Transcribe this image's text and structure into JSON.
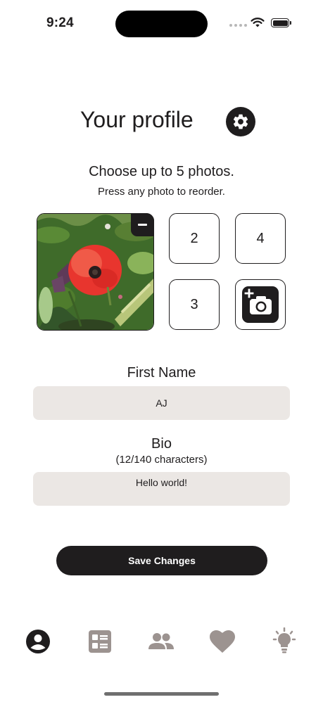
{
  "status_bar": {
    "time": "9:24"
  },
  "header": {
    "title": "Your profile",
    "settings_icon": "gear-icon"
  },
  "photos": {
    "heading": "Choose up to 5 photos.",
    "hint": "Press any photo to reorder.",
    "main_photo": "poppy-flower-photo",
    "remove_icon": "minus-icon",
    "slots": [
      "2",
      "4",
      "3"
    ],
    "add_icon": "add-photo-camera-icon"
  },
  "form": {
    "first_name_label": "First Name",
    "first_name_value": "AJ",
    "bio_label": "Bio",
    "bio_count": "(12/140 characters)",
    "bio_value": "Hello world!"
  },
  "actions": {
    "save_label": "Save Changes"
  },
  "tab_bar": {
    "items": [
      {
        "icon": "account-circle-icon",
        "active": true
      },
      {
        "icon": "list-icon",
        "active": false
      },
      {
        "icon": "group-icon",
        "active": false
      },
      {
        "icon": "heart-icon",
        "active": false
      },
      {
        "icon": "lightbulb-icon",
        "active": false
      }
    ]
  },
  "colors": {
    "primary": "#1f1d1e",
    "field_bg": "#ebe7e4",
    "inactive_icon": "#9c9390",
    "background": "#ffffff"
  }
}
